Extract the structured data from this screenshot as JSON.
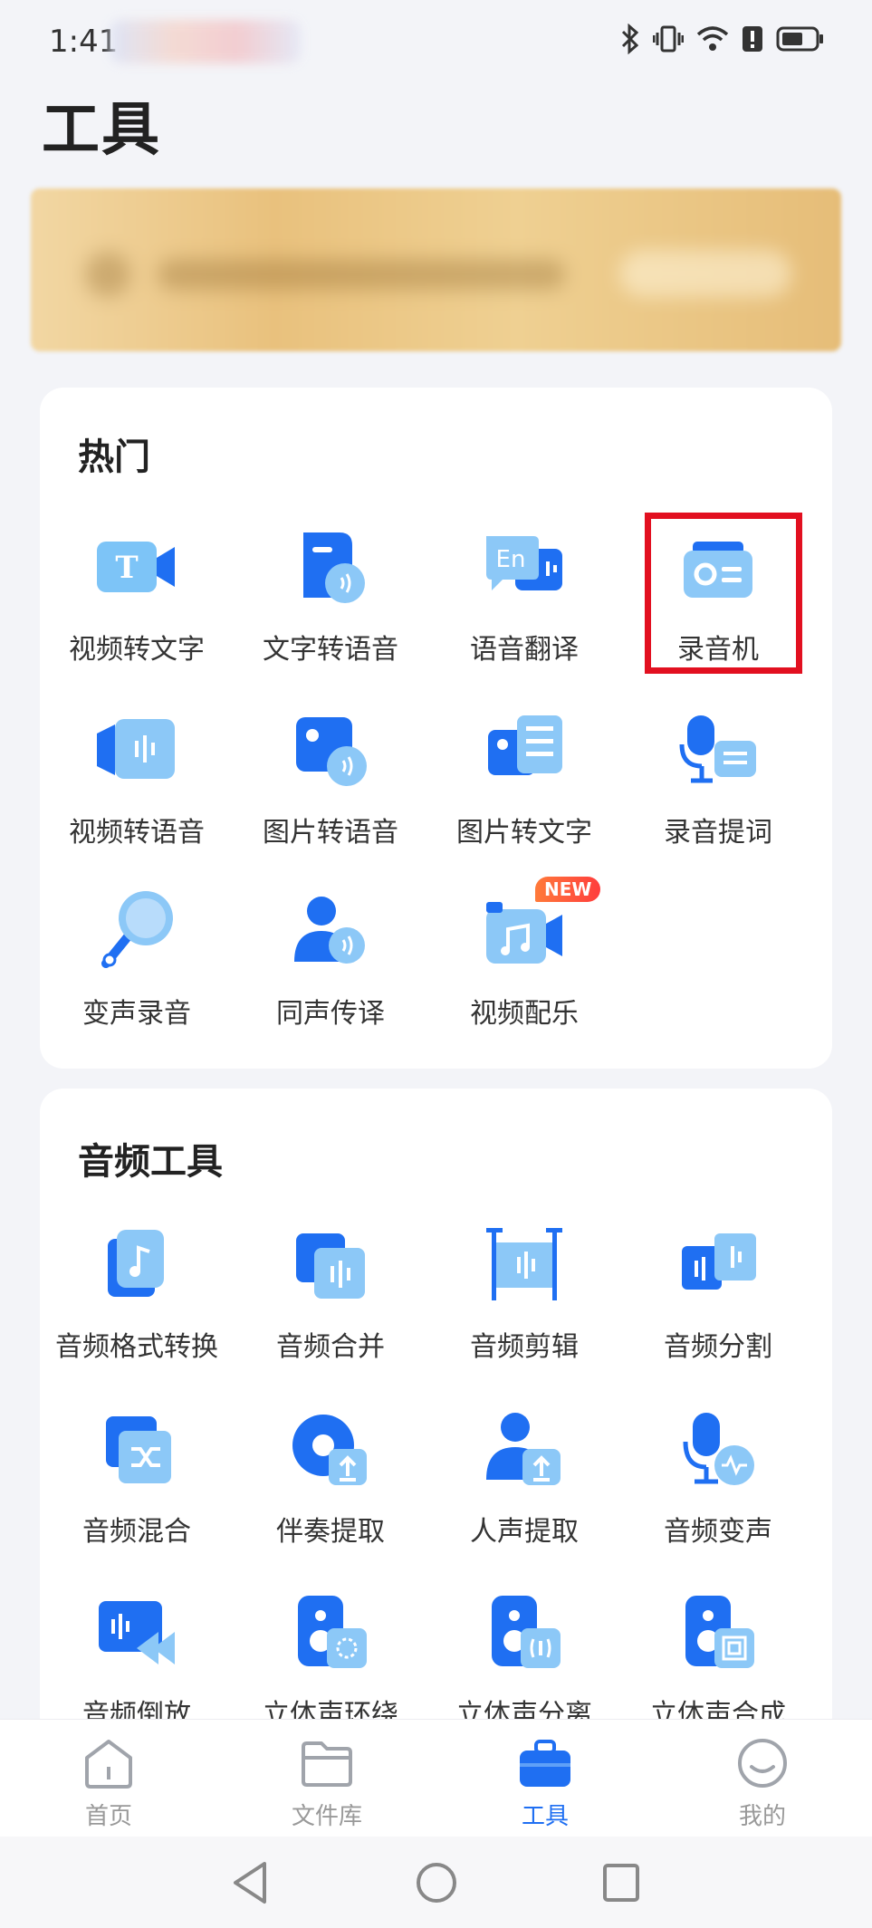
{
  "status_bar": {
    "time": "1:41"
  },
  "page_title": "工具",
  "hot_section": {
    "title": "热门",
    "items": [
      {
        "label": "视频转文字",
        "icon": "video-to-text-icon"
      },
      {
        "label": "文字转语音",
        "icon": "text-to-speech-icon"
      },
      {
        "label": "语音翻译",
        "icon": "voice-translate-icon"
      },
      {
        "label": "录音机",
        "icon": "recorder-icon"
      },
      {
        "label": "视频转语音",
        "icon": "video-to-audio-icon"
      },
      {
        "label": "图片转语音",
        "icon": "image-to-audio-icon"
      },
      {
        "label": "图片转文字",
        "icon": "image-to-text-icon"
      },
      {
        "label": "录音提词",
        "icon": "teleprompter-icon"
      },
      {
        "label": "变声录音",
        "icon": "voice-change-record-icon"
      },
      {
        "label": "同声传译",
        "icon": "simultaneous-interpret-icon"
      },
      {
        "label": "视频配乐",
        "icon": "video-music-icon",
        "badge": "NEW"
      }
    ]
  },
  "audio_section": {
    "title": "音频工具",
    "items": [
      {
        "label": "音频格式转换",
        "icon": "audio-format-convert-icon"
      },
      {
        "label": "音频合并",
        "icon": "audio-merge-icon"
      },
      {
        "label": "音频剪辑",
        "icon": "audio-cut-icon"
      },
      {
        "label": "音频分割",
        "icon": "audio-split-icon"
      },
      {
        "label": "音频混合",
        "icon": "audio-mix-icon"
      },
      {
        "label": "伴奏提取",
        "icon": "accompaniment-extract-icon"
      },
      {
        "label": "人声提取",
        "icon": "vocal-extract-icon"
      },
      {
        "label": "音频变声",
        "icon": "audio-voice-change-icon"
      },
      {
        "label": "音频倒放",
        "icon": "audio-reverse-icon"
      },
      {
        "label": "立体声环绕",
        "icon": "stereo-surround-icon"
      },
      {
        "label": "立体声分离",
        "icon": "stereo-separate-icon"
      },
      {
        "label": "立体声合成",
        "icon": "stereo-compose-icon"
      }
    ]
  },
  "bottom_nav": [
    {
      "label": "首页",
      "icon": "home-icon"
    },
    {
      "label": "文件库",
      "icon": "folder-icon"
    },
    {
      "label": "工具",
      "icon": "toolbox-icon",
      "active": true
    },
    {
      "label": "我的",
      "icon": "profile-icon"
    }
  ],
  "colors": {
    "accent": "#1f6ff2",
    "highlight": "#e21020",
    "badge": "#ff4d3a"
  }
}
